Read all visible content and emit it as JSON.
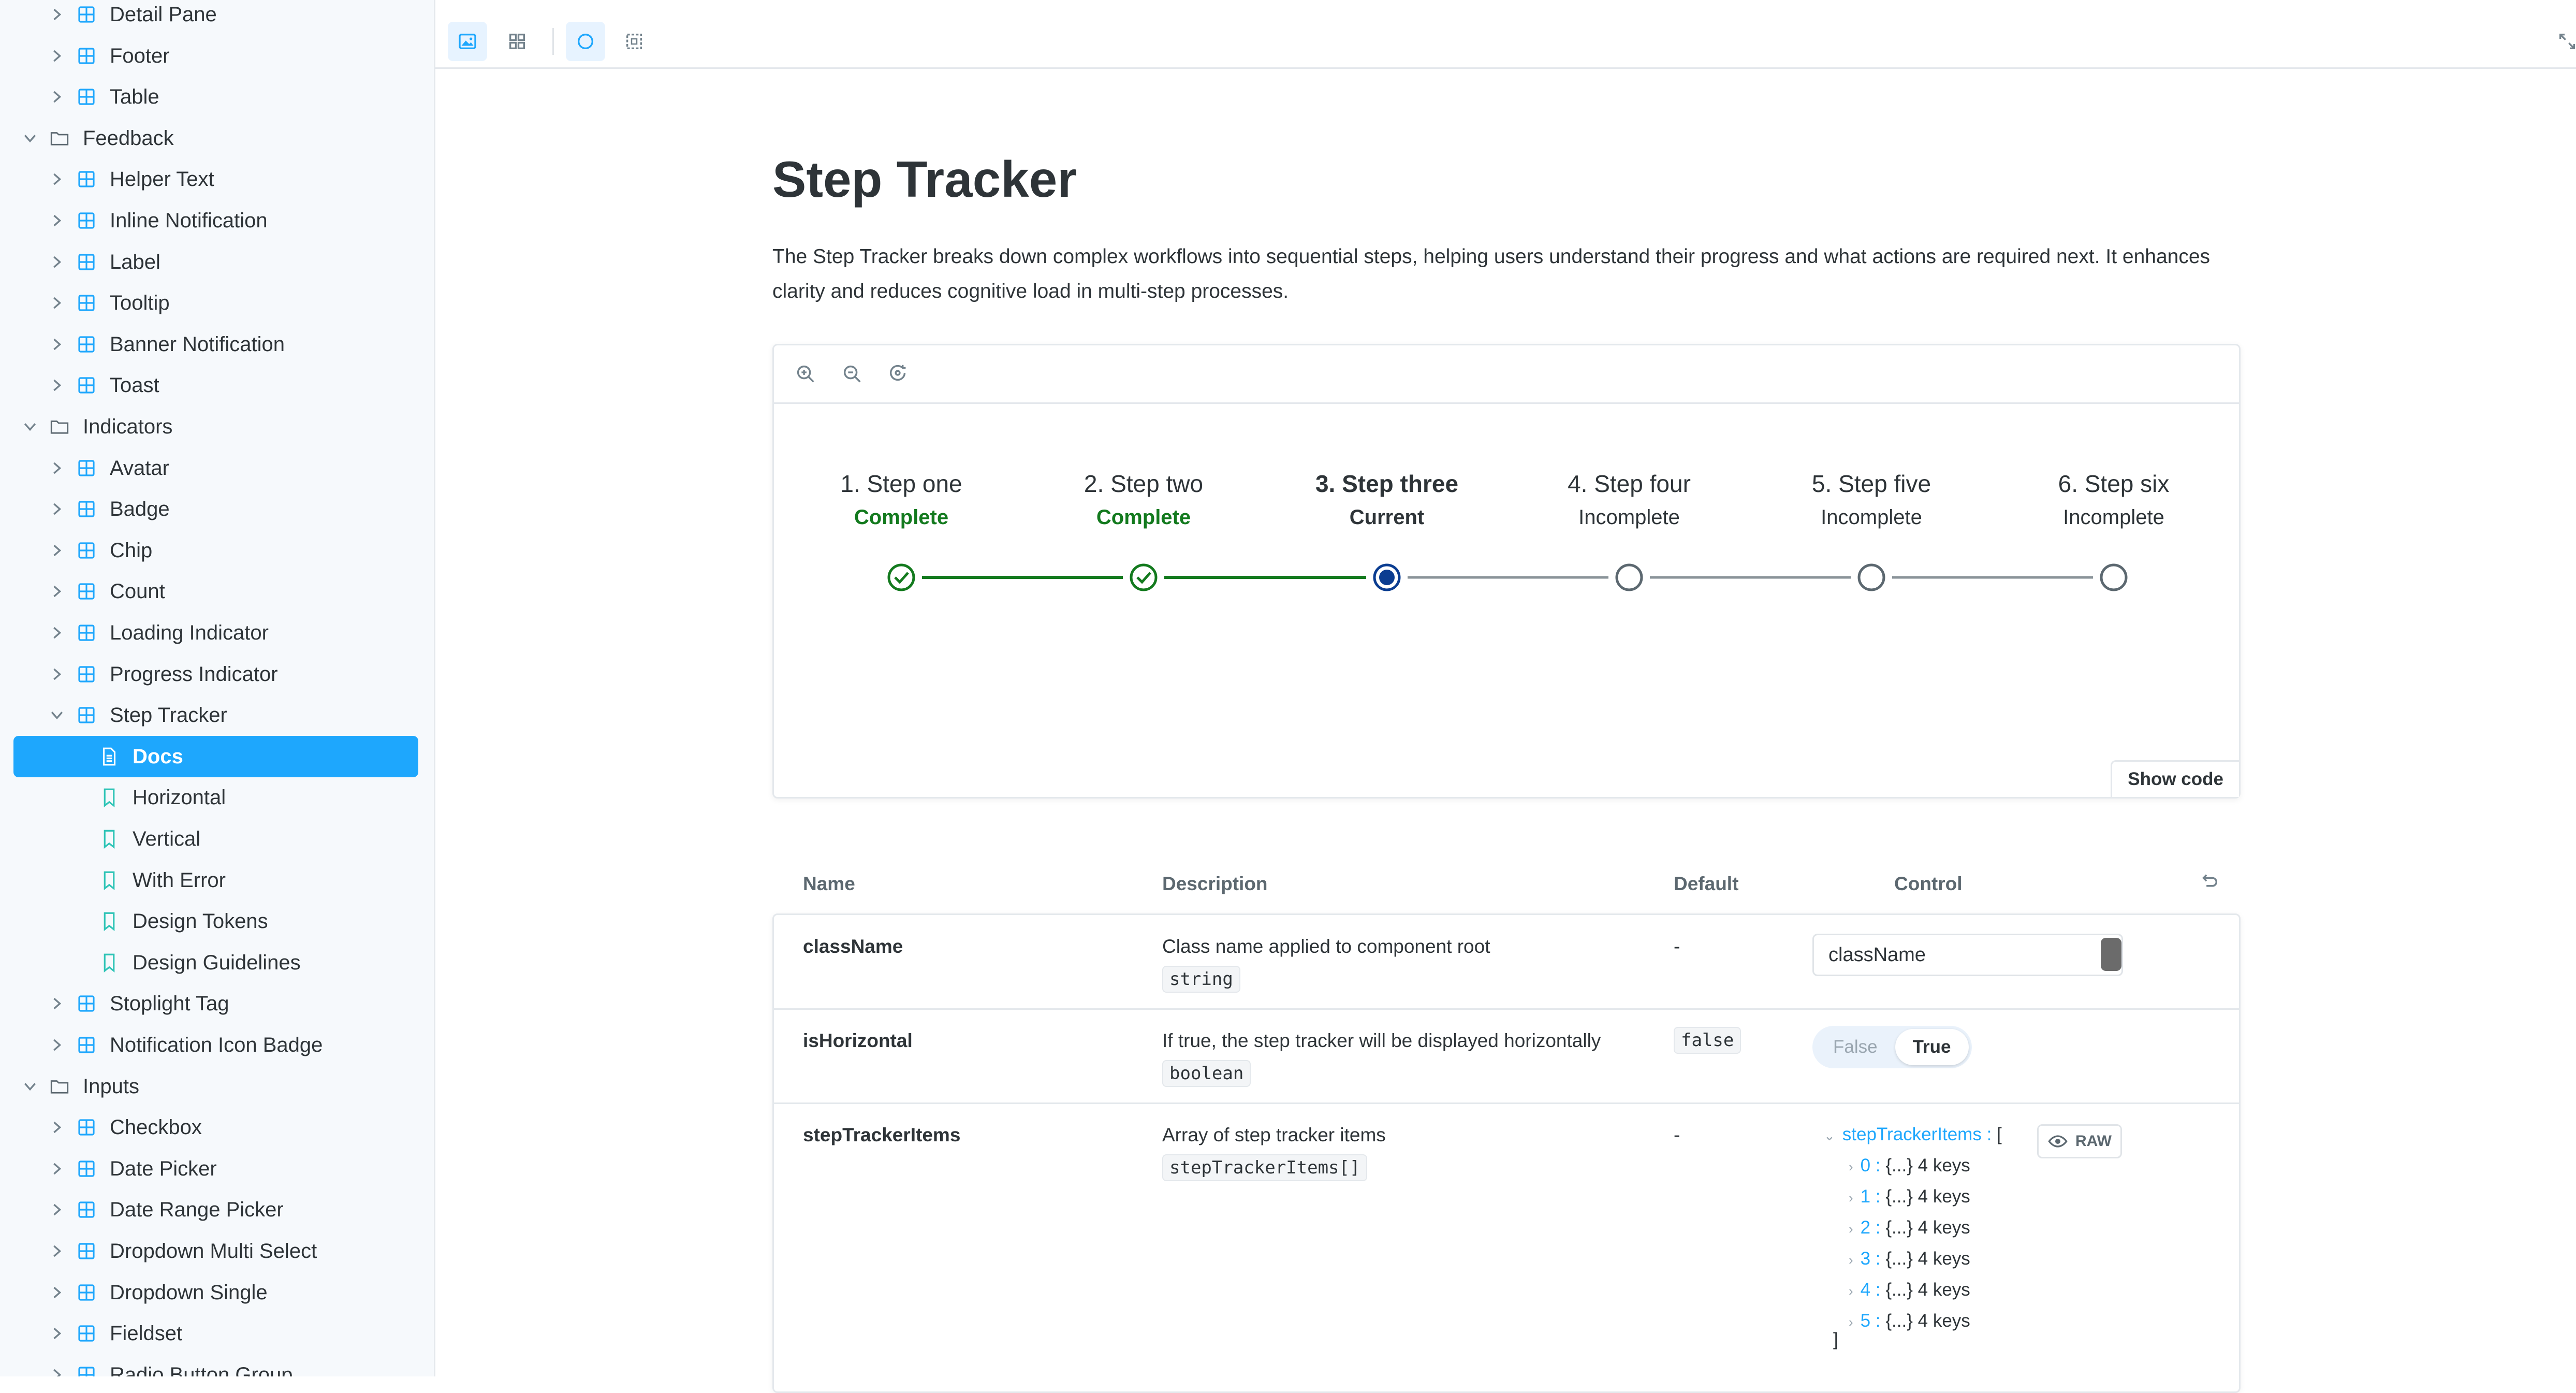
{
  "sidebar": {
    "items": [
      {
        "label": "Detail Pane",
        "type": "component",
        "level": 1
      },
      {
        "label": "Footer",
        "type": "component",
        "level": 1
      },
      {
        "label": "Table",
        "type": "component",
        "level": 1
      },
      {
        "label": "Feedback",
        "type": "group",
        "level": 0
      },
      {
        "label": "Helper Text",
        "type": "component",
        "level": 1
      },
      {
        "label": "Inline Notification",
        "type": "component",
        "level": 1
      },
      {
        "label": "Label",
        "type": "component",
        "level": 1
      },
      {
        "label": "Tooltip",
        "type": "component",
        "level": 1
      },
      {
        "label": "Banner Notification",
        "type": "component",
        "level": 1
      },
      {
        "label": "Toast",
        "type": "component",
        "level": 1
      },
      {
        "label": "Indicators",
        "type": "group",
        "level": 0
      },
      {
        "label": "Avatar",
        "type": "component",
        "level": 1
      },
      {
        "label": "Badge",
        "type": "component",
        "level": 1
      },
      {
        "label": "Chip",
        "type": "component",
        "level": 1
      },
      {
        "label": "Count",
        "type": "component",
        "level": 1
      },
      {
        "label": "Loading Indicator",
        "type": "component",
        "level": 1
      },
      {
        "label": "Progress Indicator",
        "type": "component",
        "level": 1
      },
      {
        "label": "Step Tracker",
        "type": "component-open",
        "level": 1
      },
      {
        "label": "Docs",
        "type": "docs",
        "level": 2,
        "selected": true
      },
      {
        "label": "Horizontal",
        "type": "story",
        "level": 2
      },
      {
        "label": "Vertical",
        "type": "story",
        "level": 2
      },
      {
        "label": "With Error",
        "type": "story",
        "level": 2
      },
      {
        "label": "Design Tokens",
        "type": "story",
        "level": 2
      },
      {
        "label": "Design Guidelines",
        "type": "story",
        "level": 2
      },
      {
        "label": "Stoplight Tag",
        "type": "component",
        "level": 1
      },
      {
        "label": "Notification Icon Badge",
        "type": "component",
        "level": 1
      },
      {
        "label": "Inputs",
        "type": "group",
        "level": 0
      },
      {
        "label": "Checkbox",
        "type": "component",
        "level": 1
      },
      {
        "label": "Date Picker",
        "type": "component",
        "level": 1
      },
      {
        "label": "Date Range Picker",
        "type": "component",
        "level": 1
      },
      {
        "label": "Dropdown Multi Select",
        "type": "component",
        "level": 1
      },
      {
        "label": "Dropdown Single",
        "type": "component",
        "level": 1
      },
      {
        "label": "Fieldset",
        "type": "component",
        "level": 1
      },
      {
        "label": "Radio Button Group",
        "type": "component",
        "level": 1
      }
    ]
  },
  "toolbar": {
    "icons": [
      "image-icon",
      "grid-icon",
      "circle-outline-icon",
      "frame-select-icon"
    ],
    "right_icon": "fullscreen-icon"
  },
  "doc": {
    "title": "Step Tracker",
    "description": "The Step Tracker breaks down complex workflows into sequential steps, helping users understand their progress and what actions are required next. It enhances clarity and reduces cognitive load in multi-step processes."
  },
  "canvas": {
    "tools": [
      "zoom-in-icon",
      "zoom-out-icon",
      "reset-zoom-icon"
    ],
    "show_code": "Show code"
  },
  "steps": [
    {
      "label": "1. Step one",
      "status": "Complete",
      "state": "complete"
    },
    {
      "label": "2. Step two",
      "status": "Complete",
      "state": "complete"
    },
    {
      "label": "3. Step three",
      "status": "Current",
      "state": "current"
    },
    {
      "label": "4. Step four",
      "status": "Incomplete",
      "state": "incomplete"
    },
    {
      "label": "5. Step five",
      "status": "Incomplete",
      "state": "incomplete"
    },
    {
      "label": "6. Step six",
      "status": "Incomplete",
      "state": "incomplete"
    }
  ],
  "colors": {
    "accent": "#1ea7fd",
    "complete": "#137a1e",
    "current": "#0b3d91",
    "incomplete": "#5c6870",
    "line_incomplete": "#8a9399"
  },
  "args_table": {
    "headers": {
      "name": "Name",
      "description": "Description",
      "default": "Default",
      "control": "Control"
    },
    "rows": [
      {
        "name": "className",
        "description": "Class name applied to component root",
        "type": "string",
        "default": "-",
        "control_value": "className"
      },
      {
        "name": "isHorizontal",
        "description": "If true, the step tracker will be displayed horizontally",
        "type": "boolean",
        "default": "false",
        "toggle": {
          "off": "False",
          "on": "True"
        }
      },
      {
        "name": "stepTrackerItems",
        "description": "Array of step tracker items",
        "type": "stepTrackerItems[]",
        "default": "-"
      }
    ],
    "json_view": {
      "root_key": "stepTrackerItems",
      "open": "[",
      "close": "]",
      "entries": [
        {
          "key": "0",
          "value": "{...}",
          "count": "4 keys"
        },
        {
          "key": "1",
          "value": "{...}",
          "count": "4 keys"
        },
        {
          "key": "2",
          "value": "{...}",
          "count": "4 keys"
        },
        {
          "key": "3",
          "value": "{...}",
          "count": "4 keys"
        },
        {
          "key": "4",
          "value": "{...}",
          "count": "4 keys"
        },
        {
          "key": "5",
          "value": "{...}",
          "count": "4 keys"
        }
      ],
      "raw_label": "RAW"
    }
  }
}
